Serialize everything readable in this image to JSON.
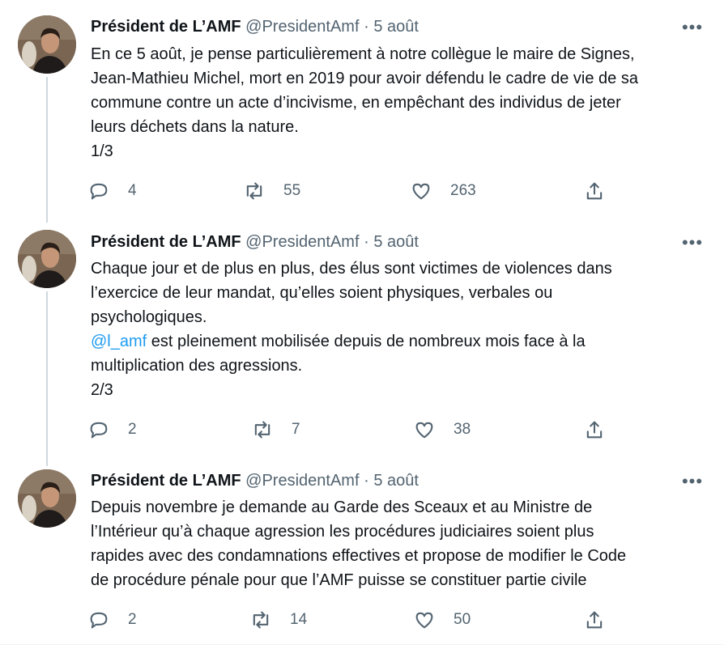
{
  "tweets": [
    {
      "author_name": "Président de L’AMF",
      "handle": "@PresidentAmf",
      "separator": "·",
      "date": "5 août",
      "more": "•••",
      "lines": [
        "En ce 5 août, je pense particulièrement à notre collègue le maire de Signes,",
        "Jean-Mathieu Michel, mort en 2019 pour avoir défendu le cadre de vie de sa",
        "commune contre un acte d’incivisme, en empêchant des individus de jeter",
        "leurs déchets dans la nature.",
        "1/3"
      ],
      "replies": "4",
      "retweets": "55",
      "likes": "263"
    },
    {
      "author_name": "Président de L’AMF",
      "handle": "@PresidentAmf",
      "separator": "·",
      "date": "5 août",
      "more": "•••",
      "lines": [
        "Chaque jour et de plus en plus, des élus sont victimes de violences dans",
        "l’exercice de leur mandat, qu’elles soient physiques, verbales ou",
        "psychologiques."
      ],
      "mention": "@l_amf",
      "mention_rest": " est pleinement mobilisée depuis de nombreux mois face à la",
      "lines_after": [
        "multiplication des agressions.",
        "2/3"
      ],
      "replies": "2",
      "retweets": "7",
      "likes": "38"
    },
    {
      "author_name": "Président de L’AMF",
      "handle": "@PresidentAmf",
      "separator": "·",
      "date": "5 août",
      "more": "•••",
      "lines": [
        "Depuis novembre je demande au Garde des Sceaux et au Ministre de",
        "l’Intérieur qu’à chaque agression les procédures judiciaires soient plus",
        "rapides avec des condamnations effectives et propose de modifier le Code",
        "de procédure pénale pour que l’AMF puisse se constituer partie civile"
      ],
      "replies": "2",
      "retweets": "14",
      "likes": "50"
    }
  ],
  "colors": {
    "text": "#0f1419",
    "secondary": "#536471",
    "link": "#1d9bf0",
    "thread": "#cfd9de"
  },
  "icons": [
    "avatar-photo",
    "reply-icon",
    "retweet-icon",
    "like-icon",
    "share-icon",
    "more-icon"
  ]
}
